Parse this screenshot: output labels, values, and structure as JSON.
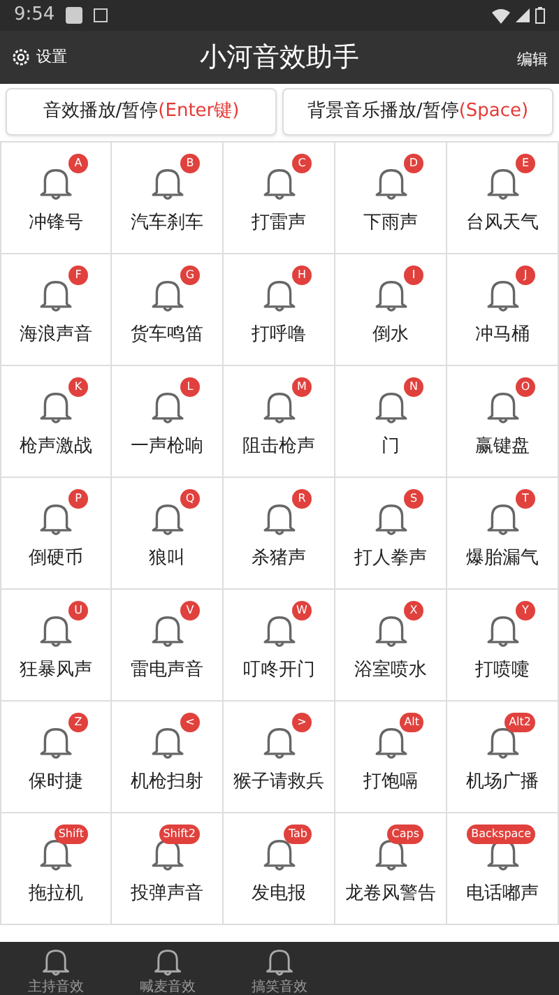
{
  "status_bar": {
    "time": "9:54"
  },
  "app_bar": {
    "settings_label": "设置",
    "title": "小河音效助手",
    "edit_label": "编辑"
  },
  "controls": [
    {
      "label": "音效播放/暂停",
      "hotkey": "(Enter键)"
    },
    {
      "label": "背景音乐播放/暂停",
      "hotkey": "(Space)"
    }
  ],
  "sounds": [
    {
      "name": "冲锋号",
      "key": "A"
    },
    {
      "name": "汽车刹车",
      "key": "B"
    },
    {
      "name": "打雷声",
      "key": "C"
    },
    {
      "name": "下雨声",
      "key": "D"
    },
    {
      "name": "台风天气",
      "key": "E"
    },
    {
      "name": "海浪声音",
      "key": "F"
    },
    {
      "name": "货车鸣笛",
      "key": "G"
    },
    {
      "name": "打呼噜",
      "key": "H"
    },
    {
      "name": "倒水",
      "key": "I"
    },
    {
      "name": "冲马桶",
      "key": "J"
    },
    {
      "name": "枪声激战",
      "key": "K"
    },
    {
      "name": "一声枪响",
      "key": "L"
    },
    {
      "name": "阻击枪声",
      "key": "M"
    },
    {
      "name": "门",
      "key": "N"
    },
    {
      "name": "赢键盘",
      "key": "O"
    },
    {
      "name": "倒硬币",
      "key": "P"
    },
    {
      "name": "狼叫",
      "key": "Q"
    },
    {
      "name": "杀猪声",
      "key": "R"
    },
    {
      "name": "打人拳声",
      "key": "S"
    },
    {
      "name": "爆胎漏气",
      "key": "T"
    },
    {
      "name": "狂暴风声",
      "key": "U"
    },
    {
      "name": "雷电声音",
      "key": "V"
    },
    {
      "name": "叮咚开门",
      "key": "W"
    },
    {
      "name": "浴室喷水",
      "key": "X"
    },
    {
      "name": "打喷嚏",
      "key": "Y"
    },
    {
      "name": "保时捷",
      "key": "Z"
    },
    {
      "name": "机枪扫射",
      "key": "<"
    },
    {
      "name": "猴子请救兵",
      "key": ">"
    },
    {
      "name": "打饱嗝",
      "key": "Alt"
    },
    {
      "name": "机场广播",
      "key": "Alt2"
    },
    {
      "name": "拖拉机",
      "key": "Shift"
    },
    {
      "name": "投弹声音",
      "key": "Shift2"
    },
    {
      "name": "发电报",
      "key": "Tab"
    },
    {
      "name": "龙卷风警告",
      "key": "Caps"
    },
    {
      "name": "电话嘟声",
      "key": "Backspace"
    }
  ],
  "bottom_nav": [
    {
      "label": "主持音效"
    },
    {
      "label": "喊麦音效"
    },
    {
      "label": "搞笑音效"
    }
  ]
}
